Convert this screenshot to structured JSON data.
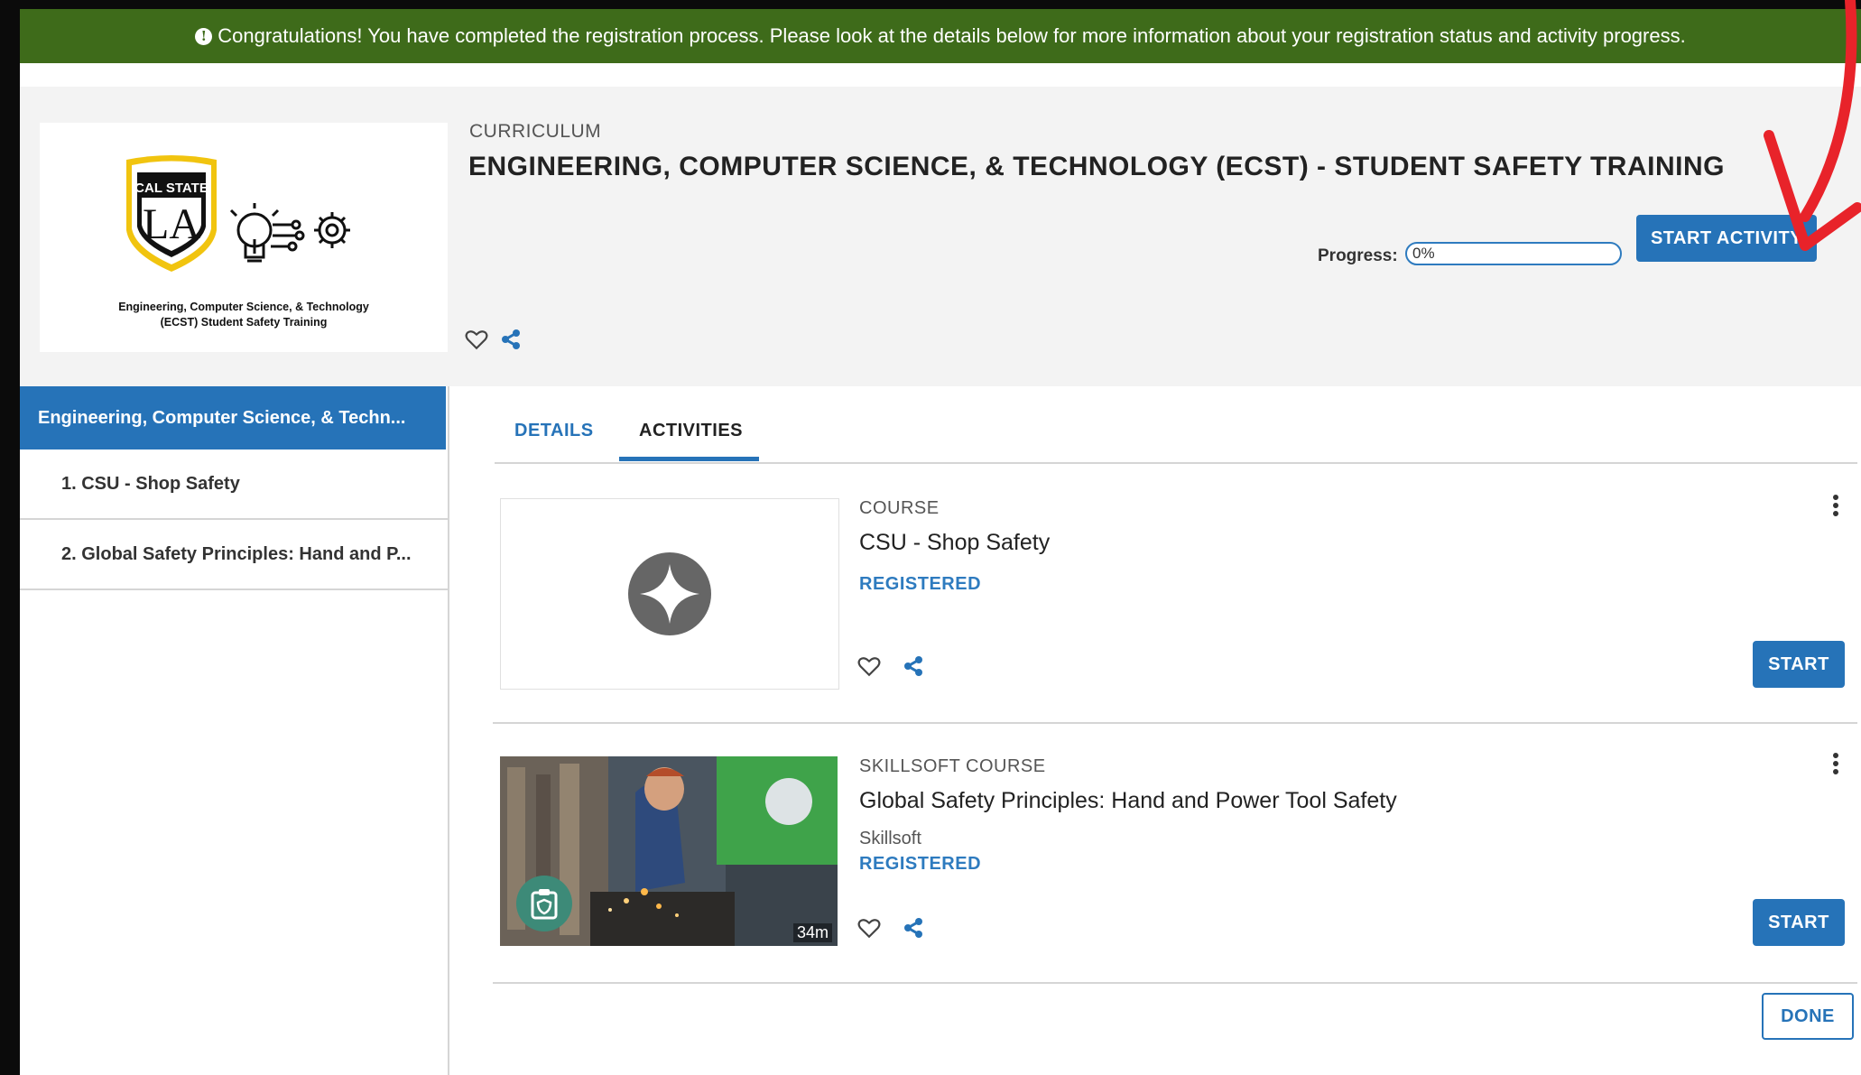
{
  "banner": {
    "message": "Congratulations! You have completed the registration process. Please look at the details below for more information about your registration status and activity progress."
  },
  "curriculum": {
    "type_label": "CURRICULUM",
    "title": "ENGINEERING, COMPUTER SCIENCE, & TECHNOLOGY (ECST) - STUDENT SAFETY TRAINING",
    "logo": {
      "cal_state": "CAL STATE",
      "la": "LA",
      "caption_line1": "Engineering, Computer Science, & Technology",
      "caption_line2": "(ECST) Student Safety Training"
    },
    "progress_label": "Progress:",
    "progress_text": "0%",
    "progress_value": 0,
    "start_button": "START ACTIVITY"
  },
  "sidebar": {
    "active": "Engineering, Computer Science, & Techn...",
    "items": [
      {
        "label": "1. CSU - Shop Safety"
      },
      {
        "label": "2. Global Safety Principles: Hand and P..."
      }
    ]
  },
  "tabs": [
    {
      "label": "DETAILS"
    },
    {
      "label": "ACTIVITIES"
    }
  ],
  "activities": [
    {
      "type": "COURSE",
      "title": "CSU - Shop Safety",
      "status": "REGISTERED",
      "button": "START"
    },
    {
      "type": "SKILLSOFT COURSE",
      "title": "Global Safety Principles: Hand and Power Tool Safety",
      "provider": "Skillsoft",
      "status": "REGISTERED",
      "duration": "34m",
      "button": "START"
    }
  ],
  "done_button": "DONE",
  "colors": {
    "banner": "#3e6b1a",
    "primary": "#2673b8",
    "status": "#2e7bbf",
    "annotation_arrow": "#e8232a",
    "logo_gold": "#f1c40f"
  }
}
